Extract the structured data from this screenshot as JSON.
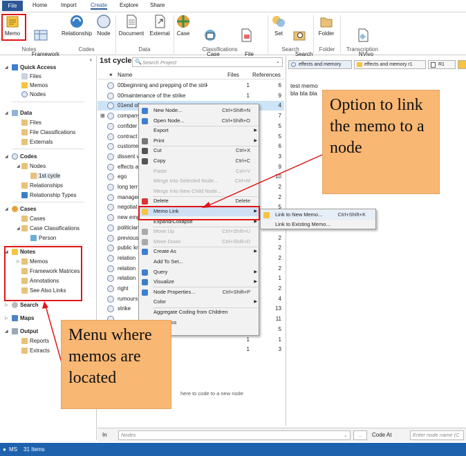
{
  "ribbon_tabs": [
    "File",
    "Home",
    "Import",
    "Create",
    "Explore",
    "Share"
  ],
  "ribbon": {
    "items": [
      {
        "label": "Memo"
      },
      {
        "label": "Framework\nMatrix"
      },
      {
        "label": "Relationship"
      },
      {
        "label": "Node"
      },
      {
        "label": "Document"
      },
      {
        "label": "External"
      },
      {
        "label": "Case"
      },
      {
        "label": "Case\nClassification"
      },
      {
        "label": "File\nClassification"
      },
      {
        "label": "Set"
      },
      {
        "label": "Search\nFolder"
      },
      {
        "label": "Folder"
      },
      {
        "label": "NVivo\nTranscription"
      }
    ],
    "groups": [
      "Notes",
      "Codes",
      "Data",
      "Classifications",
      "Search",
      "Folder",
      "Transcription"
    ]
  },
  "nav": {
    "quick_access": "Quick Access",
    "qa_items": [
      "Files",
      "Memos",
      "Nodes"
    ],
    "data": "Data",
    "data_items": [
      "Files",
      "File Classifications",
      "Externals"
    ],
    "codes": "Codes",
    "codes_items": [
      "Nodes",
      "1st cycle",
      "Relationships",
      "Relationship Types"
    ],
    "cases": "Cases",
    "cases_items": [
      "Cases",
      "Case Classifications",
      "Person"
    ],
    "notes": "Notes",
    "notes_items": [
      "Memos",
      "Framework Matrices",
      "Annotations",
      "See Also Links"
    ],
    "search": "Search",
    "maps": "Maps",
    "output": "Output",
    "output_items": [
      "Reports",
      "Extracts"
    ]
  },
  "list": {
    "title": "1st cycle",
    "search_placeholder": "Search Project",
    "col_name": "Name",
    "col_files": "Files",
    "col_refs": "References",
    "rows": [
      {
        "name": "00beginning and prepping of the strike",
        "files": "1",
        "refs": "6"
      },
      {
        "name": "00maintenance of the strike",
        "files": "1",
        "refs": "9"
      },
      {
        "name": "01end of s",
        "files": "",
        "refs": "4"
      },
      {
        "name": "company",
        "files": "",
        "refs": "7"
      },
      {
        "name": "confider",
        "files": "",
        "refs": "5"
      },
      {
        "name": "contract",
        "files": "",
        "refs": "5"
      },
      {
        "name": "custome",
        "files": "",
        "refs": "6"
      },
      {
        "name": "dissent w",
        "files": "",
        "refs": "3"
      },
      {
        "name": "effects a",
        "files": "",
        "refs": "9"
      },
      {
        "name": "ego",
        "files": "",
        "refs": "10"
      },
      {
        "name": "long terr",
        "files": "",
        "refs": "2"
      },
      {
        "name": "manager",
        "files": "",
        "refs": "2"
      },
      {
        "name": "negotiat",
        "files": "",
        "refs": "5"
      },
      {
        "name": "new emp",
        "files": "",
        "refs": "2"
      },
      {
        "name": "politician",
        "files": "",
        "refs": "3"
      },
      {
        "name": "previous",
        "files": "",
        "refs": "2"
      },
      {
        "name": "public kr",
        "files": "",
        "refs": "2"
      },
      {
        "name": "relation",
        "files": "",
        "refs": "2"
      },
      {
        "name": "relation",
        "files": "",
        "refs": "2"
      },
      {
        "name": "relation",
        "files": "",
        "refs": "1"
      },
      {
        "name": "right",
        "files": "",
        "refs": "2"
      },
      {
        "name": "rumours",
        "files": "",
        "refs": "4"
      },
      {
        "name": "strike",
        "files": "",
        "refs": "13"
      },
      {
        "name": "",
        "files": "",
        "refs": "11"
      },
      {
        "name": "",
        "files": "",
        "refs": "5"
      },
      {
        "name": "",
        "files": "1",
        "refs": "1"
      },
      {
        "name": "",
        "files": "1",
        "refs": "3"
      }
    ],
    "drop_hint": "here to code to a new node"
  },
  "detail": {
    "tabs": [
      "effects and memory",
      "effects and memory r1",
      "R1"
    ],
    "text1": "test memo",
    "text2": "bla bla bla"
  },
  "context_menu": [
    {
      "label": "New Node...",
      "shortcut": "Ctrl+Shift+N",
      "enabled": true
    },
    {
      "label": "Open Node...",
      "shortcut": "Ctrl+Shift+O",
      "enabled": true
    },
    {
      "label": "Export",
      "shortcut": "",
      "enabled": true,
      "sub": true
    },
    {
      "label": "Print",
      "shortcut": "",
      "enabled": true,
      "sub": true
    },
    {
      "label": "Cut",
      "shortcut": "Ctrl+X",
      "enabled": true
    },
    {
      "label": "Copy",
      "shortcut": "Ctrl+C",
      "enabled": true
    },
    {
      "label": "Paste",
      "shortcut": "Ctrl+V",
      "enabled": false
    },
    {
      "label": "Merge Into Selected Node...",
      "shortcut": "Ctrl+M",
      "enabled": false
    },
    {
      "label": "Merge Into New Child Node...",
      "shortcut": "",
      "enabled": false
    },
    {
      "label": "Delete",
      "shortcut": "Delete",
      "enabled": true
    },
    {
      "label": "Memo Link",
      "shortcut": "",
      "enabled": true,
      "sub": true
    },
    {
      "label": "Expand/Collapse",
      "shortcut": "",
      "enabled": true,
      "sub": true
    },
    {
      "label": "Move Up",
      "shortcut": "Ctrl+Shift+U",
      "enabled": false
    },
    {
      "label": "Move Down",
      "shortcut": "Ctrl+Shift+D",
      "enabled": false
    },
    {
      "label": "Create As",
      "shortcut": "",
      "enabled": true,
      "sub": true
    },
    {
      "label": "Add To Set...",
      "shortcut": "",
      "enabled": true
    },
    {
      "label": "Query",
      "shortcut": "",
      "enabled": true,
      "sub": true
    },
    {
      "label": "Visualize",
      "shortcut": "",
      "enabled": true,
      "sub": true
    },
    {
      "label": "Node Properties...",
      "shortcut": "Ctrl+Shift+P",
      "enabled": true
    },
    {
      "label": "Color",
      "shortcut": "",
      "enabled": true,
      "sub": true
    },
    {
      "label": "Aggregate Coding from Children",
      "shortcut": "",
      "enabled": true
    },
    {
      "label": "ck Access",
      "shortcut": "",
      "enabled": true
    }
  ],
  "submenu": [
    {
      "label": "Link to New Memo...",
      "shortcut": "Ctrl+Shift+K"
    },
    {
      "label": "Link to Existing Memo...",
      "shortcut": ""
    }
  ],
  "callouts": {
    "right": "Option to link the memo to a node",
    "left": "Menu where memos are located"
  },
  "bottom": {
    "in_label": "In",
    "nodes_placeholder": "Nodes",
    "code_at_label": "Code At",
    "code_at_placeholder": "Enter node name (C",
    "dots": "..."
  },
  "status": {
    "user": "MS",
    "count": "31 Items"
  },
  "colors": {
    "accent": "#2b5797",
    "status": "#1e62ae",
    "highlight_row": "#cde3f7",
    "menu_highlight": "#cfe0f5",
    "callout": "#f9b774",
    "annotation_red": "#e01515"
  }
}
